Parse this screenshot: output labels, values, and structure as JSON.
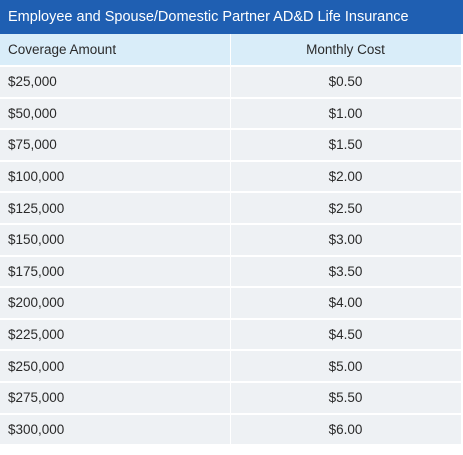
{
  "title": "Employee and Spouse/Domestic Partner AD&D Life  Insurance",
  "headers": {
    "coverage": "Coverage Amount",
    "cost": "Monthly Cost"
  },
  "rows": [
    {
      "coverage": "$25,000",
      "cost": "$0.50"
    },
    {
      "coverage": "$50,000",
      "cost": "$1.00"
    },
    {
      "coverage": "$75,000",
      "cost": "$1.50"
    },
    {
      "coverage": "$100,000",
      "cost": "$2.00"
    },
    {
      "coverage": "$125,000",
      "cost": "$2.50"
    },
    {
      "coverage": "$150,000",
      "cost": "$3.00"
    },
    {
      "coverage": "$175,000",
      "cost": "$3.50"
    },
    {
      "coverage": "$200,000",
      "cost": "$4.00"
    },
    {
      "coverage": "$225,000",
      "cost": "$4.50"
    },
    {
      "coverage": "$250,000",
      "cost": "$5.00"
    },
    {
      "coverage": "$275,000",
      "cost": "$5.50"
    },
    {
      "coverage": "$300,000",
      "cost": "$6.00"
    }
  ],
  "colors": {
    "title_bg": "#1f5fb2",
    "header_bg": "#d9edf9",
    "row_bg": "#eef1f4"
  }
}
